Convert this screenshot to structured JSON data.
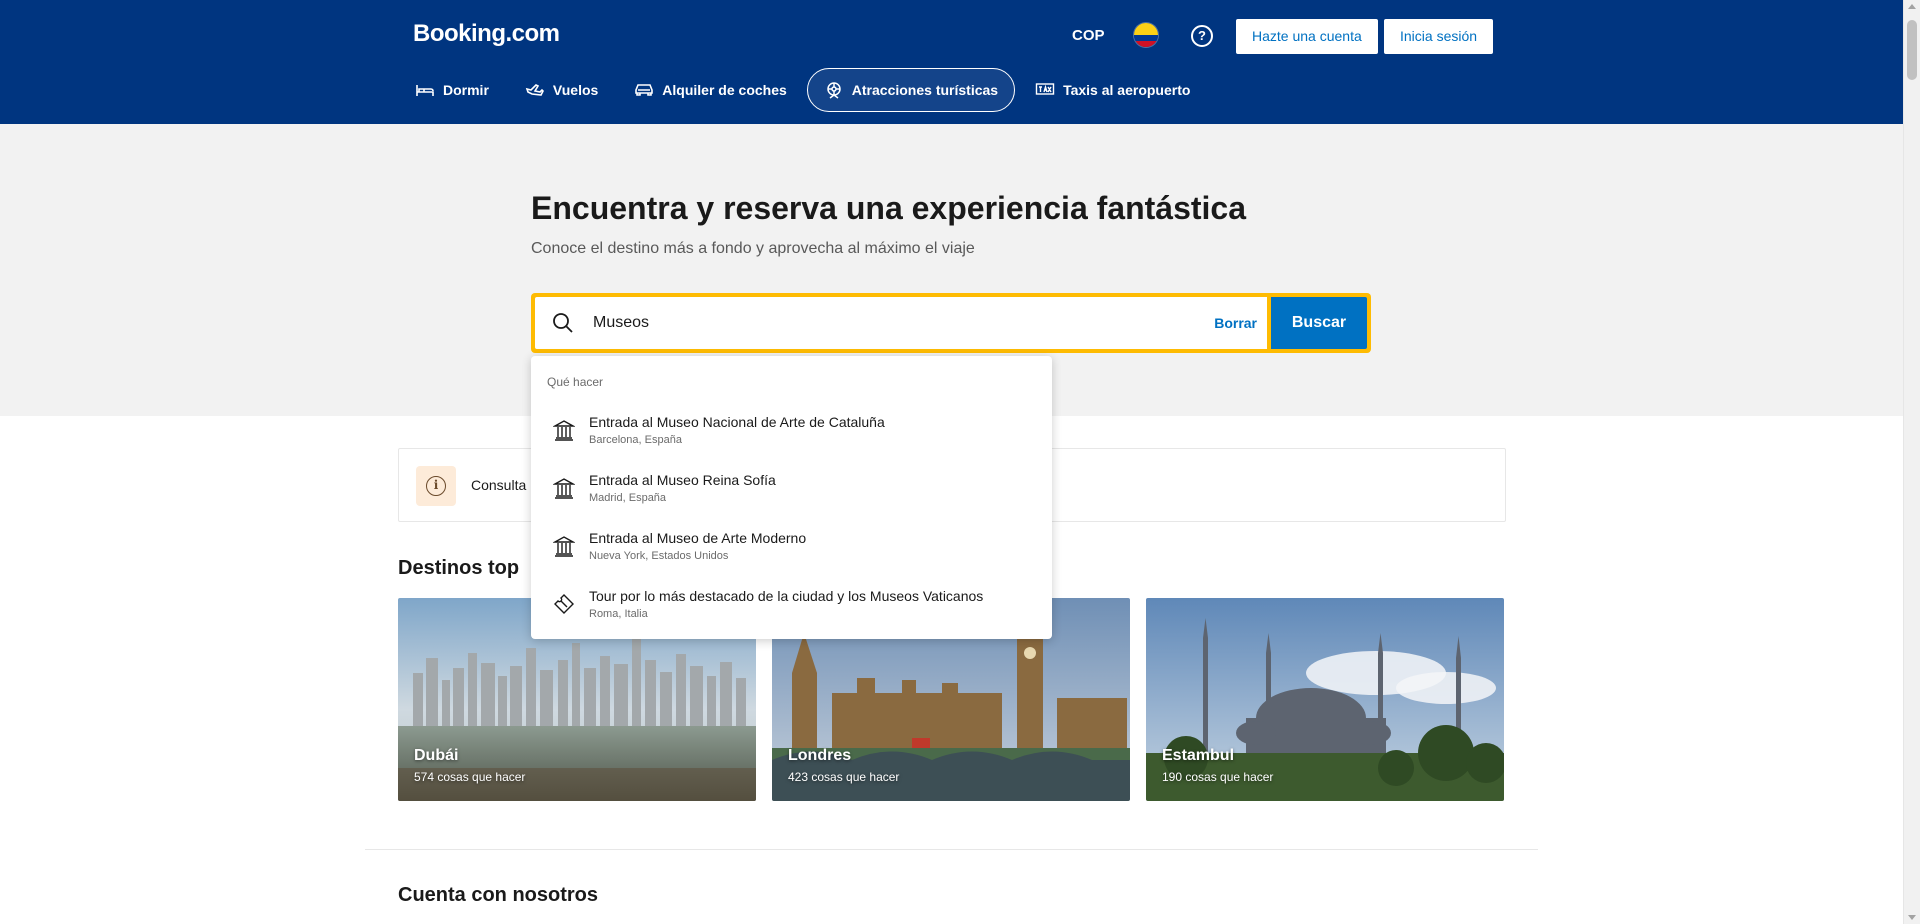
{
  "header": {
    "logo": "Booking.com",
    "currency": "COP",
    "flag_icon": "colombia-flag-icon",
    "help_icon": "?",
    "register_label": "Hazte una cuenta",
    "login_label": "Inicia sesión",
    "background_color": "#003580"
  },
  "nav": {
    "items": [
      {
        "label": "Dormir",
        "icon": "bed-icon"
      },
      {
        "label": "Vuelos",
        "icon": "plane-icon"
      },
      {
        "label": "Alquiler de coches",
        "icon": "car-icon"
      },
      {
        "label": "Atracciones turísticas",
        "icon": "attractions-icon",
        "active": true
      },
      {
        "label": "Taxis al aeropuerto",
        "icon": "taxi-icon"
      }
    ]
  },
  "hero": {
    "title": "Encuentra y reserva una experiencia fantástica",
    "subtitle": "Conoce el destino más a fondo y aprovecha al máximo el viaje"
  },
  "search": {
    "value": "Museos",
    "clear_label": "Borrar",
    "button_label": "Buscar",
    "accent_color": "#febb02",
    "button_color": "#0071c2"
  },
  "dropdown": {
    "header": "Qué hacer",
    "items": [
      {
        "title": "Entrada al Museo Nacional de Arte de Cataluña",
        "subtitle": "Barcelona, España",
        "icon": "museum-icon"
      },
      {
        "title": "Entrada al Museo Reina Sofía",
        "subtitle": "Madrid, España",
        "icon": "museum-icon"
      },
      {
        "title": "Entrada al Museo de Arte Moderno",
        "subtitle": "Nueva York, Estados Unidos",
        "icon": "museum-icon"
      },
      {
        "title": "Tour por lo más destacado de la ciudad y los Museos Vaticanos",
        "subtitle": "Roma, Italia",
        "icon": "ticket-icon"
      }
    ]
  },
  "info_banner": {
    "text": "Consulta l"
  },
  "destinations": {
    "title": "Destinos top",
    "cards": [
      {
        "name": "Dubái",
        "count": "574 cosas que hacer"
      },
      {
        "name": "Londres",
        "count": "423 cosas que hacer"
      },
      {
        "name": "Estambul",
        "count": "190 cosas que hacer"
      }
    ]
  },
  "trust": {
    "title": "Cuenta con nosotros"
  }
}
